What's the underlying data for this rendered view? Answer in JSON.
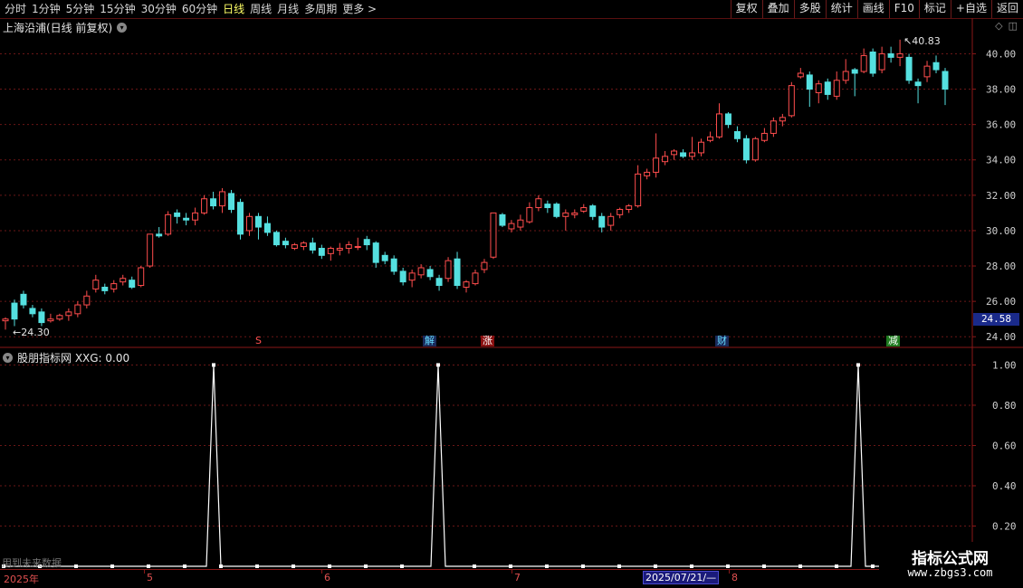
{
  "toolbar": {
    "periods": [
      "分时",
      "1分钟",
      "5分钟",
      "15分钟",
      "30分钟",
      "60分钟",
      "日线",
      "周线",
      "月线",
      "多周期",
      "更多 >"
    ],
    "active_period": "日线",
    "buttons": [
      "复权",
      "叠加",
      "多股",
      "统计",
      "画线",
      "F10",
      "标记",
      "+自选",
      "返回"
    ]
  },
  "chart_title": "上海沿浦(日线 前复权)",
  "indicator_title": "股朋指标网 XXG: 0.00",
  "current_price": "24.58",
  "colors": {
    "up": "#ff4d4d",
    "down": "#55e0e0",
    "grid": "#6a1616",
    "line": "#ffffff"
  },
  "chart_data": [
    {
      "type": "candlestick",
      "ylim": [
        23.5,
        41.2
      ],
      "y_ticks": [
        "40.00",
        "38.00",
        "36.00",
        "34.00",
        "32.00",
        "30.00",
        "28.00",
        "26.00",
        "24.00"
      ],
      "annotations": {
        "low": "24.30",
        "high": "40.83"
      },
      "event_tags": [
        "S",
        "解",
        "涨",
        "财",
        "减"
      ],
      "candles": [
        [
          24.9,
          25.0,
          24.4,
          25.1
        ],
        [
          25.9,
          25.0,
          24.6,
          26.1
        ],
        [
          26.4,
          25.8,
          25.6,
          26.6
        ],
        [
          25.6,
          25.3,
          25.1,
          25.8
        ],
        [
          25.4,
          24.8,
          24.6,
          25.6
        ],
        [
          24.9,
          25.0,
          24.8,
          25.3
        ],
        [
          25.0,
          25.2,
          24.9,
          25.3
        ],
        [
          25.2,
          25.4,
          24.9,
          25.6
        ],
        [
          25.3,
          25.8,
          25.1,
          26.0
        ],
        [
          25.8,
          26.3,
          25.6,
          26.6
        ],
        [
          26.7,
          27.2,
          26.5,
          27.5
        ],
        [
          26.8,
          26.6,
          26.4,
          27.0
        ],
        [
          26.7,
          27.0,
          26.5,
          27.2
        ],
        [
          27.1,
          27.3,
          26.9,
          27.5
        ],
        [
          27.2,
          26.8,
          26.7,
          27.4
        ],
        [
          26.9,
          27.9,
          26.8,
          28.0
        ],
        [
          28.0,
          29.8,
          27.9,
          29.8
        ],
        [
          29.8,
          29.7,
          29.6,
          30.2
        ],
        [
          29.8,
          30.9,
          29.7,
          31.1
        ],
        [
          31.0,
          30.8,
          30.4,
          31.2
        ],
        [
          30.7,
          30.6,
          30.3,
          31.0
        ],
        [
          30.6,
          31.0,
          30.3,
          31.3
        ],
        [
          31.0,
          31.8,
          30.9,
          32.0
        ],
        [
          31.8,
          31.4,
          31.2,
          32.2
        ],
        [
          31.4,
          32.2,
          31.0,
          32.4
        ],
        [
          32.1,
          31.2,
          31.0,
          32.3
        ],
        [
          31.6,
          29.8,
          29.5,
          31.8
        ],
        [
          30.0,
          30.8,
          29.7,
          31.0
        ],
        [
          30.8,
          30.2,
          29.5,
          31.0
        ],
        [
          30.4,
          29.9,
          29.7,
          30.8
        ],
        [
          29.9,
          29.2,
          29.1,
          30.0
        ],
        [
          29.4,
          29.2,
          29.0,
          29.6
        ],
        [
          29.0,
          29.2,
          28.9,
          29.3
        ],
        [
          29.1,
          29.3,
          28.9,
          29.4
        ],
        [
          29.3,
          28.9,
          28.7,
          29.6
        ],
        [
          29.0,
          28.6,
          28.4,
          29.2
        ],
        [
          28.7,
          29.0,
          28.3,
          29.1
        ],
        [
          28.9,
          29.0,
          28.6,
          29.3
        ],
        [
          29.0,
          29.2,
          28.7,
          29.4
        ],
        [
          29.1,
          29.1,
          28.9,
          29.6
        ],
        [
          29.5,
          29.2,
          28.9,
          29.7
        ],
        [
          29.3,
          28.2,
          27.9,
          29.4
        ],
        [
          28.6,
          28.3,
          28.1,
          28.8
        ],
        [
          28.4,
          27.7,
          27.5,
          28.6
        ],
        [
          27.7,
          27.1,
          26.9,
          27.9
        ],
        [
          27.2,
          27.6,
          26.8,
          27.8
        ],
        [
          27.5,
          27.9,
          27.3,
          28.1
        ],
        [
          27.8,
          27.4,
          27.2,
          28.0
        ],
        [
          27.3,
          26.9,
          26.6,
          27.5
        ],
        [
          27.3,
          28.3,
          27.1,
          28.5
        ],
        [
          28.4,
          26.9,
          26.7,
          28.8
        ],
        [
          26.8,
          27.1,
          26.5,
          27.2
        ],
        [
          27.0,
          27.6,
          26.9,
          27.8
        ],
        [
          27.8,
          28.2,
          27.6,
          28.4
        ],
        [
          28.5,
          31.0,
          28.4,
          31.0
        ],
        [
          30.9,
          30.3,
          30.2,
          31.0
        ],
        [
          30.1,
          30.4,
          29.9,
          30.6
        ],
        [
          30.2,
          30.6,
          30.0,
          30.9
        ],
        [
          30.5,
          31.3,
          30.4,
          31.6
        ],
        [
          31.3,
          31.8,
          31.1,
          32.0
        ],
        [
          31.5,
          31.3,
          31.0,
          31.7
        ],
        [
          31.5,
          30.8,
          30.7,
          31.6
        ],
        [
          30.8,
          31.0,
          30.0,
          31.2
        ],
        [
          30.9,
          31.0,
          30.7,
          31.2
        ],
        [
          31.1,
          31.3,
          31.0,
          31.5
        ],
        [
          31.4,
          30.8,
          30.6,
          31.5
        ],
        [
          30.8,
          30.2,
          29.9,
          31.0
        ],
        [
          30.3,
          30.8,
          30.0,
          31.0
        ],
        [
          30.9,
          31.2,
          30.7,
          31.3
        ],
        [
          31.2,
          31.4,
          31.0,
          31.5
        ],
        [
          31.4,
          33.2,
          31.3,
          33.7
        ],
        [
          33.1,
          33.3,
          32.9,
          33.5
        ],
        [
          33.3,
          34.1,
          33.0,
          35.5
        ],
        [
          33.9,
          34.2,
          33.7,
          34.5
        ],
        [
          34.3,
          34.5,
          34.0,
          34.6
        ],
        [
          34.4,
          34.2,
          34.1,
          34.6
        ],
        [
          34.2,
          34.4,
          34.0,
          35.3
        ],
        [
          34.4,
          35.0,
          34.2,
          35.2
        ],
        [
          35.1,
          35.3,
          35.0,
          35.6
        ],
        [
          35.3,
          36.6,
          35.2,
          37.2
        ],
        [
          36.6,
          36.0,
          35.8,
          36.7
        ],
        [
          35.6,
          35.2,
          35.0,
          35.9
        ],
        [
          35.2,
          34.0,
          33.8,
          35.4
        ],
        [
          34.0,
          35.2,
          33.9,
          35.3
        ],
        [
          35.1,
          35.5,
          35.0,
          35.8
        ],
        [
          35.5,
          36.2,
          35.3,
          36.4
        ],
        [
          36.2,
          36.4,
          35.9,
          36.6
        ],
        [
          36.5,
          38.2,
          36.4,
          38.4
        ],
        [
          38.7,
          38.9,
          38.6,
          39.2
        ],
        [
          38.8,
          38.0,
          37.0,
          39.0
        ],
        [
          37.8,
          38.3,
          37.2,
          38.5
        ],
        [
          38.4,
          37.7,
          37.4,
          38.6
        ],
        [
          37.6,
          38.5,
          37.4,
          39.0
        ],
        [
          38.5,
          39.0,
          38.3,
          39.7
        ],
        [
          39.1,
          38.9,
          37.6,
          39.2
        ],
        [
          39.0,
          39.9,
          38.9,
          40.3
        ],
        [
          40.1,
          38.9,
          38.7,
          40.3
        ],
        [
          39.1,
          40.0,
          38.9,
          40.4
        ],
        [
          40.0,
          39.8,
          39.5,
          40.4
        ],
        [
          39.8,
          40.0,
          39.3,
          40.8
        ],
        [
          39.8,
          38.5,
          38.3,
          40.0
        ],
        [
          38.4,
          38.2,
          37.2,
          38.6
        ],
        [
          38.7,
          39.3,
          38.4,
          39.6
        ],
        [
          39.5,
          39.1,
          38.9,
          39.9
        ],
        [
          39.0,
          38.0,
          37.1,
          39.2
        ]
      ]
    },
    {
      "type": "line",
      "title": "XXG",
      "ylim": [
        0,
        1.02
      ],
      "y_ticks": [
        "1.00",
        "0.80",
        "0.60",
        "0.40",
        "0.20"
      ],
      "peak_indices": [
        29,
        60,
        118
      ],
      "n": 128
    }
  ],
  "date_axis": [
    "2025年",
    "5",
    "6",
    "7",
    "2025/07/21/—",
    "8"
  ],
  "footer_note": "用到未来数据",
  "watermark": {
    "title": "指标公式网",
    "url": "www.zbgs3.com"
  }
}
